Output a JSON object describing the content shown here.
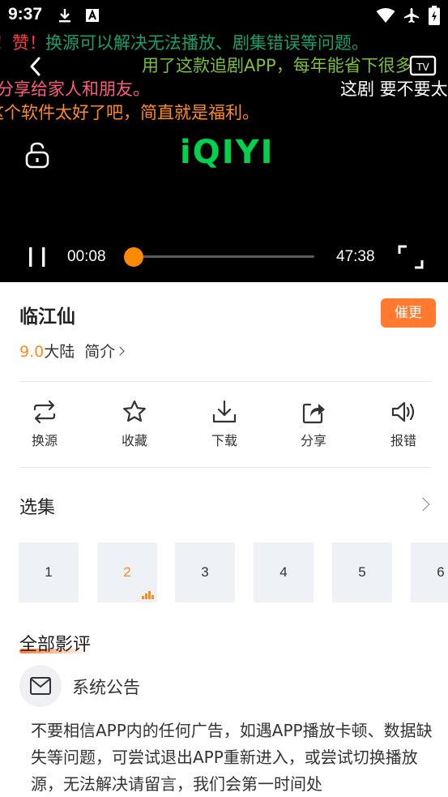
{
  "status_bar": {
    "time": "9:37",
    "icons": [
      "download-icon",
      "font-icon",
      "wifi-icon",
      "airplane-icon",
      "battery-icon"
    ]
  },
  "player": {
    "logo": "iQIYI",
    "current_time": "00:08",
    "duration": "47:38",
    "progress": 0.003,
    "danmaku": [
      {
        "text": "！赞！",
        "color": "#ff3b3b"
      },
      {
        "text": "换源可以解决无法播放、剧集错误等问题。",
        "color": "#19a06a"
      },
      {
        "text": "用了这款追剧APP，每年能省下很多",
        "color": "#7cbf3a"
      },
      {
        "text": "分享给家人和朋友。",
        "color": "#ff5a7a"
      },
      {
        "text": "这剧 要不要太",
        "color": "#ffffff"
      },
      {
        "text": "这个软件太好了吧，简直就是福利。",
        "color": "#ff8a1f"
      }
    ],
    "colors": {
      "accent": "#ff8a00",
      "logo": "#00d24b"
    }
  },
  "show": {
    "title": "临江仙",
    "urge_button": "催更",
    "score": "9.0",
    "region": "大陆",
    "intro_label": "简介"
  },
  "actions": [
    {
      "label": "换源",
      "icon": "swap-source-icon"
    },
    {
      "label": "收藏",
      "icon": "star-icon"
    },
    {
      "label": "下载",
      "icon": "download-icon"
    },
    {
      "label": "分享",
      "icon": "share-icon"
    },
    {
      "label": "报错",
      "icon": "speaker-icon"
    }
  ],
  "episodes": {
    "title": "选集",
    "items": [
      "1",
      "2",
      "3",
      "4",
      "5",
      "6"
    ],
    "active": "2"
  },
  "reviews": {
    "title": "全部影评",
    "author": "系统公告",
    "content": "不要相信APP内的任何广告，如遇APP播放卡顿、数据缺失等问题，可尝试退出APP重新进入，或尝试切换播放源，无法解决请留言，我们会第一时间处"
  }
}
